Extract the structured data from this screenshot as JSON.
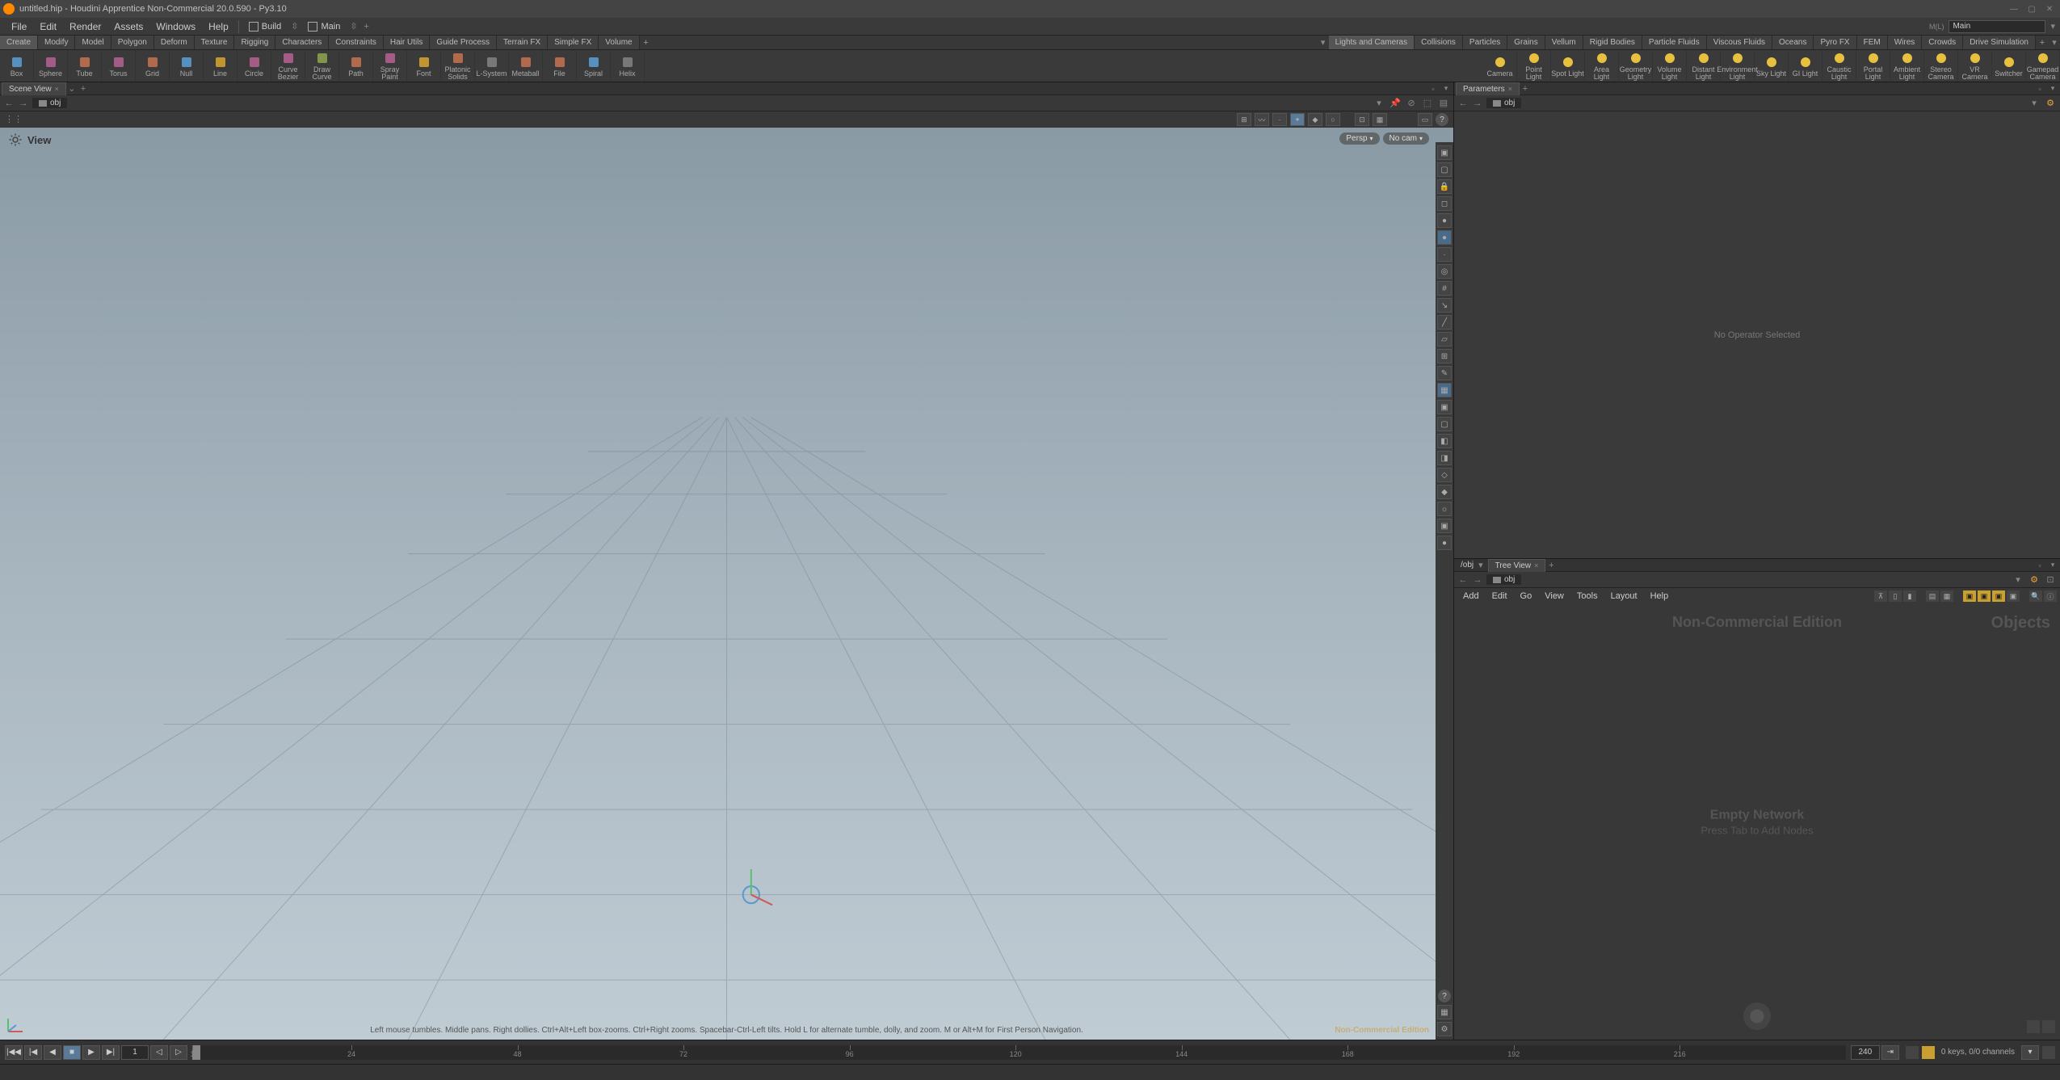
{
  "title": "untitled.hip - Houdini Apprentice Non-Commercial 20.0.590 - Py3.10",
  "menubar": [
    "File",
    "Edit",
    "Render",
    "Assets",
    "Windows",
    "Help"
  ],
  "layouts": {
    "build": "Build",
    "main": "Main"
  },
  "main_input": "Main",
  "shelf_left_tabs": [
    "Create",
    "Modify",
    "Model",
    "Polygon",
    "Deform",
    "Texture",
    "Rigging",
    "Characters",
    "Constraints",
    "Hair Utils",
    "Guide Process",
    "Terrain FX",
    "Simple FX",
    "Volume"
  ],
  "shelf_right_tabs": [
    "Lights and Cameras",
    "Collisions",
    "Particles",
    "Grains",
    "Vellum",
    "Rigid Bodies",
    "Particle Fluids",
    "Viscous Fluids",
    "Oceans",
    "Pyro FX",
    "FEM",
    "Wires",
    "Crowds",
    "Drive Simulation"
  ],
  "shelf_tools_left": [
    "Box",
    "Sphere",
    "Tube",
    "Torus",
    "Grid",
    "Null",
    "Line",
    "Circle",
    "Curve Bezier",
    "Draw Curve",
    "Path",
    "Spray Paint",
    "Font",
    "Platonic Solids",
    "L-System",
    "Metaball",
    "File",
    "Spiral",
    "Helix"
  ],
  "shelf_tools_right": [
    "Camera",
    "Point Light",
    "Spot Light",
    "Area Light",
    "Geometry Light",
    "Volume Light",
    "Distant Light",
    "Environment Light",
    "Sky Light",
    "GI Light",
    "Caustic Light",
    "Portal Light",
    "Ambient Light",
    "Stereo Camera",
    "VR Camera",
    "Switcher",
    "Gamepad Camera"
  ],
  "panes": {
    "scene_view": {
      "tab": "Scene View",
      "path_chip": "obj"
    },
    "parameters": {
      "tab": "Parameters",
      "path_chip": "obj",
      "empty": "No Operator Selected"
    },
    "treeview": {
      "tab": "Tree View",
      "path_chip": "obj"
    }
  },
  "viewport": {
    "title": "View",
    "cam_pills": [
      "Persp",
      "No cam"
    ],
    "hint": "Left mouse tumbles. Middle pans. Right dollies. Ctrl+Alt+Left box-zooms. Ctrl+Right zooms. Spacebar-Ctrl-Left tilts. Hold L for alternate tumble, dolly, and zoom. M or Alt+M for First Person Navigation.",
    "watermark": "Non-Commercial Edition"
  },
  "network": {
    "menu": [
      "Add",
      "Edit",
      "Go",
      "View",
      "Tools",
      "Layout",
      "Help"
    ],
    "edition": "Non-Commercial Edition",
    "context": "Objects",
    "empty_l1": "Empty Network",
    "empty_l2": "Press Tab to Add Nodes"
  },
  "timeline": {
    "frame": "1",
    "ticks": [
      1,
      24,
      48,
      72,
      96,
      120,
      144,
      168,
      192,
      216
    ],
    "end": "240",
    "keys_info": "0 keys, 0/0 channels"
  }
}
